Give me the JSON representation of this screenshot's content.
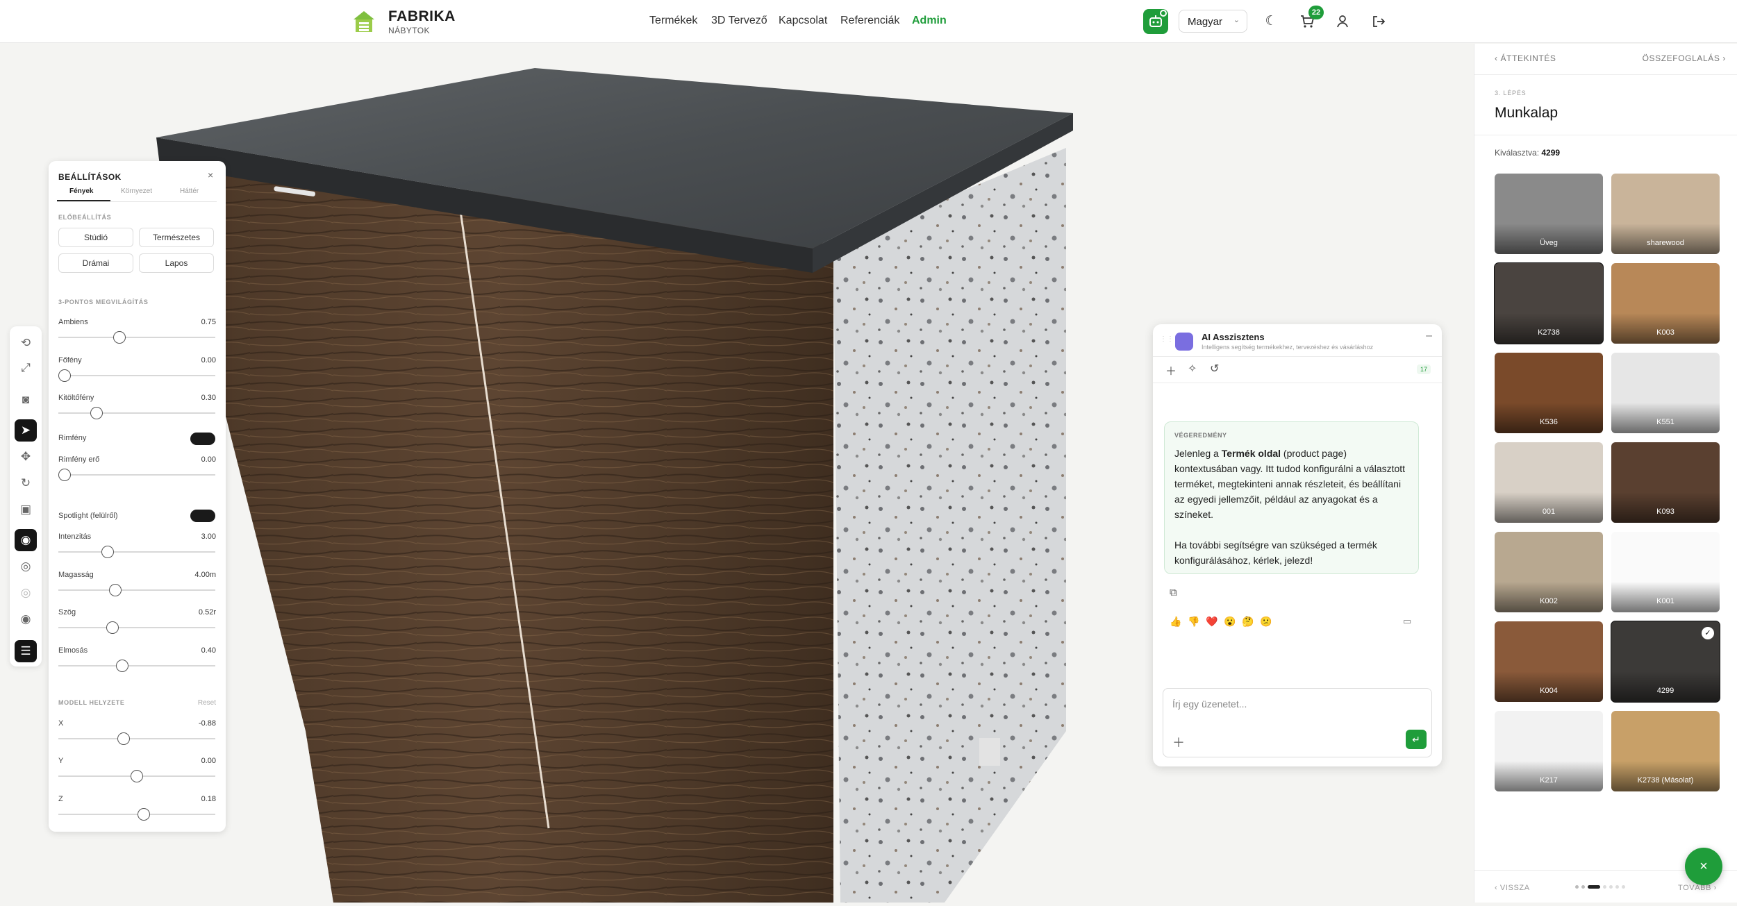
{
  "brand": {
    "title": "FABRIKA",
    "subtitle": "NÁBYTOK"
  },
  "nav": [
    "Termékek",
    "3D Tervező",
    "Kapcsolat",
    "Referenciák",
    "Admin"
  ],
  "header": {
    "language": "Magyar",
    "cart_count": "22"
  },
  "colors": {
    "accent": "#1f9d3a",
    "dark": "#151515"
  },
  "settings": {
    "title": "BEÁLLÍTÁSOK",
    "tabs": [
      "Fények",
      "Környezet",
      "Háttér"
    ],
    "presets_title": "ELŐBEÁLLÍTÁS",
    "presets": [
      "Stúdió",
      "Természetes",
      "Drámai",
      "Lapos"
    ],
    "lighting_title": "3-PONTOS MEGVILÁGÍTÁS",
    "sliders": [
      {
        "label": "Ambiens",
        "value": "0.75",
        "level": 0.38
      },
      {
        "label": "Főfény",
        "value": "0.00",
        "level": 0.0
      },
      {
        "label": "Kitöltőfény",
        "value": "0.30",
        "level": 0.22
      },
      {
        "label": "Rimfény erő",
        "value": "0.00",
        "level": 0.0
      },
      {
        "label": "Intenzitás",
        "value": "3.00",
        "level": 0.3
      },
      {
        "label": "Magasság",
        "value": "4.00m",
        "level": 0.35
      },
      {
        "label": "Szög",
        "value": "0.52r",
        "level": 0.33
      },
      {
        "label": "Elmosás",
        "value": "0.40",
        "level": 0.4
      }
    ],
    "rimlight_label": "Rimfény",
    "spotlight_label": "Spotlight (felülről)",
    "model_title": "MODELL HELYZETE",
    "reset_label": "Reset",
    "position": [
      {
        "label": "X",
        "value": "-0.88",
        "level": 0.41
      },
      {
        "label": "Y",
        "value": "0.00",
        "level": 0.5
      },
      {
        "label": "Z",
        "value": "0.18",
        "level": 0.55
      }
    ]
  },
  "ai": {
    "title": "AI Asszisztens",
    "subtitle": "Intelligens segítség termékekhez, tervezéshez és vásárláshoz",
    "token_count": "17",
    "result_tag": "VÉGEREDMÉNY",
    "msg_pre": "Jelenleg a ",
    "msg_bold": "Termék oldal",
    "msg_post": " (product page) kontextusában vagy. Itt tudod konfigurálni a választott terméket, megtekinteni annak részleteit, és beállítani az egyedi jellemzőit, például az anyagokat és a színeket.",
    "msg_2": "Ha további segítségre van szükséged a termék konfigurálásához, kérlek, jelezd!",
    "reactions": [
      "👍",
      "👎",
      "❤️",
      "😮",
      "🤔",
      "😕"
    ],
    "input_placeholder": "Írj egy üzenetet..."
  },
  "panel": {
    "back_top": "ÁTTEKINTÉS",
    "next_top": "ÖSSZEFOGLALÁS",
    "step": "3. LÉPÉS",
    "title": "Munkalap",
    "selected_label": "Kiválasztva:",
    "selected_value": "4299",
    "swatches": [
      {
        "label": "Üveg",
        "color": "#8a8a8a"
      },
      {
        "label": "sharewood",
        "color": "#c9b49a"
      },
      {
        "label": "K2738",
        "color": "#4a4440"
      },
      {
        "label": "K003",
        "color": "#b88858"
      },
      {
        "label": "K536",
        "color": "#7a4a2a"
      },
      {
        "label": "K551",
        "color": "#e6e6e6"
      },
      {
        "label": "001",
        "color": "#d8d0c6"
      },
      {
        "label": "K093",
        "color": "#5a4030"
      },
      {
        "label": "K002",
        "color": "#b8a890"
      },
      {
        "label": "K001",
        "color": "#fafafa"
      },
      {
        "label": "K004",
        "color": "#8a5a3a"
      },
      {
        "label": "4299",
        "color": "#3c3a38"
      },
      {
        "label": "K217",
        "color": "#f2f2f2"
      },
      {
        "label": "K2738 (Másolat)",
        "color": "#c8a068"
      }
    ],
    "back_bottom": "VISSZA",
    "next_bottom": "TOVÁBB"
  }
}
